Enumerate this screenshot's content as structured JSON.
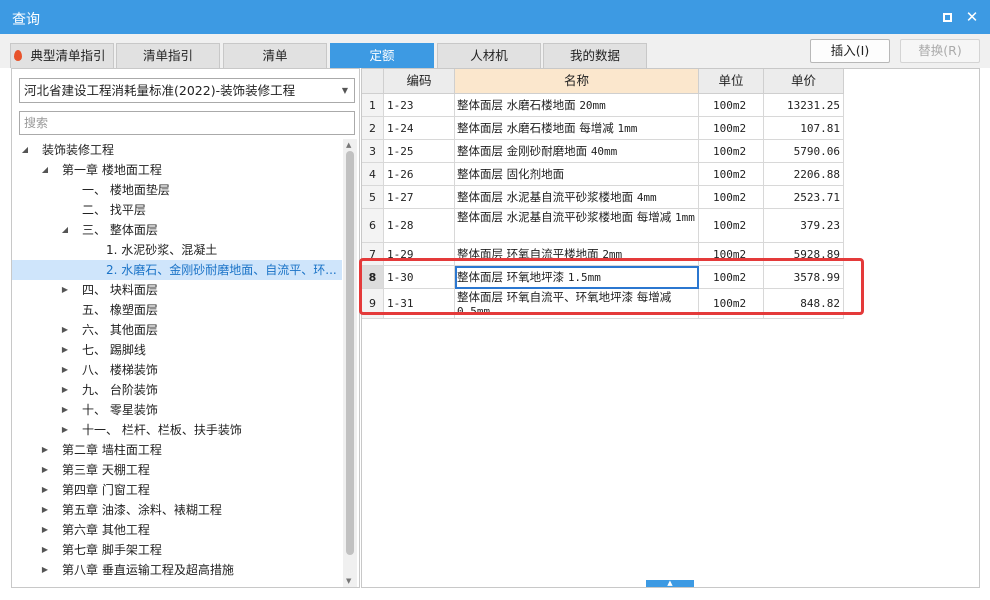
{
  "window": {
    "title": "查询",
    "maximize_icon": "maximize-icon",
    "close_glyph": "✕"
  },
  "tabs": [
    {
      "label": "典型清单指引",
      "active": false
    },
    {
      "label": "清单指引",
      "active": false
    },
    {
      "label": "清单",
      "active": false
    },
    {
      "label": "定额",
      "active": true
    },
    {
      "label": "人材机",
      "active": false
    },
    {
      "label": "我的数据",
      "active": false
    }
  ],
  "toolbar": {
    "insert_label": "插入(I)",
    "replace_label": "替换(R)"
  },
  "left": {
    "selected_standard": "河北省建设工程消耗量标准(2022)-装饰装修工程",
    "search_placeholder": "搜索",
    "tree": [
      {
        "label": "装饰装修工程",
        "level": 0,
        "state": "expanded"
      },
      {
        "label": "第一章 楼地面工程",
        "level": 1,
        "state": "expanded"
      },
      {
        "label": "一、 楼地面垫层",
        "level": 2,
        "state": "leaf"
      },
      {
        "label": "二、 找平层",
        "level": 2,
        "state": "leaf"
      },
      {
        "label": "三、 整体面层",
        "level": 2,
        "state": "expanded"
      },
      {
        "label": "1. 水泥砂浆、混凝土",
        "level": 3,
        "state": "leaf"
      },
      {
        "label": "2. 水磨石、金刚砂耐磨地面、自流平、环...",
        "level": 3,
        "state": "leaf",
        "selected": true
      },
      {
        "label": "四、 块料面层",
        "level": 2,
        "state": "collapsed"
      },
      {
        "label": "五、 橡塑面层",
        "level": 2,
        "state": "leaf"
      },
      {
        "label": "六、 其他面层",
        "level": 2,
        "state": "collapsed"
      },
      {
        "label": "七、 踢脚线",
        "level": 2,
        "state": "collapsed"
      },
      {
        "label": "八、 楼梯装饰",
        "level": 2,
        "state": "collapsed"
      },
      {
        "label": "九、 台阶装饰",
        "level": 2,
        "state": "collapsed"
      },
      {
        "label": "十、 零星装饰",
        "level": 2,
        "state": "collapsed"
      },
      {
        "label": "十一、 栏杆、栏板、扶手装饰",
        "level": 2,
        "state": "collapsed"
      },
      {
        "label": "第二章 墙柱面工程",
        "level": 1,
        "state": "collapsed"
      },
      {
        "label": "第三章 天棚工程",
        "level": 1,
        "state": "collapsed"
      },
      {
        "label": "第四章 门窗工程",
        "level": 1,
        "state": "collapsed"
      },
      {
        "label": "第五章 油漆、涂料、裱糊工程",
        "level": 1,
        "state": "collapsed"
      },
      {
        "label": "第六章 其他工程",
        "level": 1,
        "state": "collapsed"
      },
      {
        "label": "第七章 脚手架工程",
        "level": 1,
        "state": "collapsed"
      },
      {
        "label": "第八章 垂直运输工程及超高措施",
        "level": 1,
        "state": "collapsed"
      }
    ]
  },
  "grid": {
    "columns": [
      "编码",
      "名称",
      "单位",
      "单价"
    ],
    "rows": [
      {
        "num": "1",
        "code": "1-23",
        "name_text": "整体面层 水磨石楼地面",
        "name_spec": "20mm",
        "unit": "100m2",
        "price": "13231.25"
      },
      {
        "num": "2",
        "code": "1-24",
        "name_text": "整体面层 水磨石楼地面 每增减",
        "name_spec": "1mm",
        "unit": "100m2",
        "price": "107.81"
      },
      {
        "num": "3",
        "code": "1-25",
        "name_text": "整体面层 金刚砂耐磨地面",
        "name_spec": "40mm",
        "unit": "100m2",
        "price": "5790.06"
      },
      {
        "num": "4",
        "code": "1-26",
        "name_text": "整体面层 固化剂地面",
        "name_spec": "",
        "unit": "100m2",
        "price": "2206.88"
      },
      {
        "num": "5",
        "code": "1-27",
        "name_text": "整体面层 水泥基自流平砂浆楼地面",
        "name_spec": "4mm",
        "unit": "100m2",
        "price": "2523.71"
      },
      {
        "num": "6",
        "code": "1-28",
        "name_text": "整体面层 水泥基自流平砂浆楼地面 每增减",
        "name_spec": "1mm",
        "unit": "100m2",
        "price": "379.23"
      },
      {
        "num": "7",
        "code": "1-29",
        "name_text": "整体面层 环氧自流平楼地面",
        "name_spec": "2mm",
        "unit": "100m2",
        "price": "5928.89"
      },
      {
        "num": "8",
        "code": "1-30",
        "name_text": "整体面层 环氧地坪漆",
        "name_spec": "1.5mm",
        "unit": "100m2",
        "price": "3578.99",
        "current": true
      },
      {
        "num": "9",
        "code": "1-31",
        "name_text": "整体面层 环氧自流平、环氧地坪漆 每增减",
        "name_spec": "0.5mm",
        "unit": "100m2",
        "price": "848.82"
      }
    ]
  },
  "colors": {
    "accent": "#3d9ae3",
    "highlight_box": "#e43a3a",
    "selection": "#cfe5fb"
  }
}
